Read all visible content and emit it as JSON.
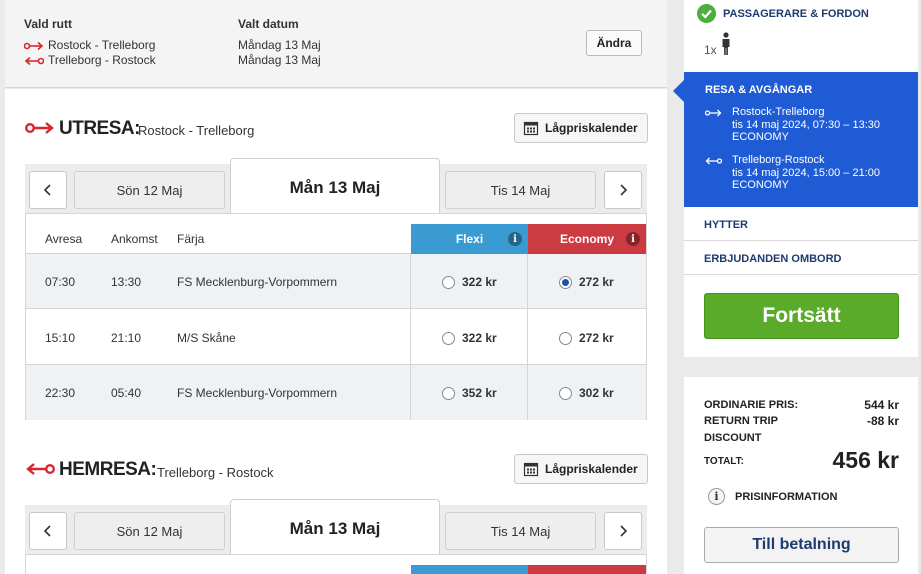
{
  "summary": {
    "route_header": "Vald rutt",
    "date_header": "Valt datum",
    "routes": [
      {
        "route": "Rostock - Trelleborg",
        "date": "Måndag 13 Maj"
      },
      {
        "route": "Trelleborg - Rostock",
        "date": "Måndag 13 Maj"
      }
    ],
    "change_label": "Ändra"
  },
  "outbound": {
    "title": "UTRESA:",
    "route": "Rostock - Trelleborg",
    "calendar_label": "Lågpriskalender",
    "dates": {
      "prev": "Sön 12 Maj",
      "active": "Mån 13 Maj",
      "next": "Tis 14 Maj"
    },
    "columns": {
      "depart": "Avresa",
      "arrive": "Ankomst",
      "ferry": "Färja",
      "flexi": "Flexi",
      "economy": "Economy"
    },
    "rows": [
      {
        "depart": "07:30",
        "arrive": "13:30",
        "ferry": "FS Mecklenburg-Vorpommern",
        "flexi": "322 kr",
        "economy": "272 kr",
        "selected": "economy"
      },
      {
        "depart": "15:10",
        "arrive": "21:10",
        "ferry": "M/S Skåne",
        "flexi": "322 kr",
        "economy": "272 kr",
        "selected": ""
      },
      {
        "depart": "22:30",
        "arrive": "05:40",
        "ferry": "FS Mecklenburg-Vorpommern",
        "flexi": "352 kr",
        "economy": "302 kr",
        "selected": ""
      }
    ]
  },
  "return": {
    "title": "HEMRESA:",
    "route": "Trelleborg - Rostock",
    "calendar_label": "Lågpriskalender",
    "dates": {
      "prev": "Sön 12 Maj",
      "active": "Mån 13 Maj",
      "next": "Tis 14 Maj"
    }
  },
  "side": {
    "passengers_title": "PASSAGERARE & FORDON",
    "passenger_count": "1x",
    "trips_title": "RESA & AVGÅNGAR",
    "trips": [
      {
        "route": "Rostock-Trelleborg",
        "when": "tis 14 maj 2024, 07:30 – 13:30",
        "class": "ECONOMY"
      },
      {
        "route": "Trelleborg-Rostock",
        "when": "tis 14 maj 2024, 15:00 – 21:00",
        "class": "ECONOMY"
      }
    ],
    "cabins": "HYTTER",
    "offers": "ERBJUDANDEN OMBORD",
    "continue_label": "Fortsätt"
  },
  "pricing": {
    "ordinary_label": "ORDINARIE PRIS:",
    "ordinary_value": "544 kr",
    "discount_label_1": "RETURN TRIP",
    "discount_label_2": "DISCOUNT",
    "discount_value": "-88 kr",
    "total_label": "TOTALT:",
    "total_value": "456 kr",
    "info_label": "PRISINFORMATION",
    "pay_label": "Till betalning"
  },
  "colors": {
    "flexi": "#3a9bd2",
    "economy": "#cc3a42",
    "accent_red": "#d7262e",
    "side_blue": "#1e5bd4",
    "continue_green": "#5aab2a"
  }
}
